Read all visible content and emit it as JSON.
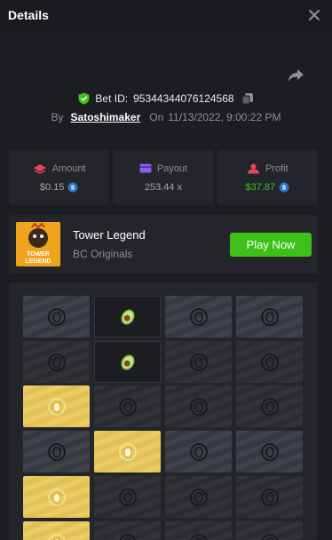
{
  "header": {
    "title": "Details"
  },
  "bet": {
    "label": "Bet ID:",
    "id": "95344344076124568",
    "by_label": "By",
    "user": "Satoshimaker",
    "on_label": "On",
    "datetime": "11/13/2022, 9:00:22 PM"
  },
  "stats": {
    "amount": {
      "label": "Amount",
      "value": "$0.15"
    },
    "payout": {
      "label": "Payout",
      "value": "253.44 x"
    },
    "profit": {
      "label": "Profit",
      "value": "$37.87"
    }
  },
  "game": {
    "name": "Tower Legend",
    "provider": "BC Originals",
    "play_label": "Play Now",
    "thumb_text": [
      "TOWER",
      "LEGEND"
    ]
  },
  "board": {
    "rows": [
      [
        "gray",
        "avocado",
        "gray",
        "gray"
      ],
      [
        "dark",
        "avocado",
        "dark",
        "dark"
      ],
      [
        "gold-egg",
        "dark",
        "dark",
        "dark"
      ],
      [
        "gray",
        "gold-egg",
        "gray",
        "gray"
      ],
      [
        "gold-egg",
        "dark",
        "dark",
        "dark"
      ],
      [
        "gold-egg",
        "dark",
        "dark",
        "dark"
      ]
    ]
  },
  "colors": {
    "accent_green": "#3bc117",
    "gold": "#e9c758",
    "panel": "#24252b",
    "background": "#1c1d21"
  }
}
